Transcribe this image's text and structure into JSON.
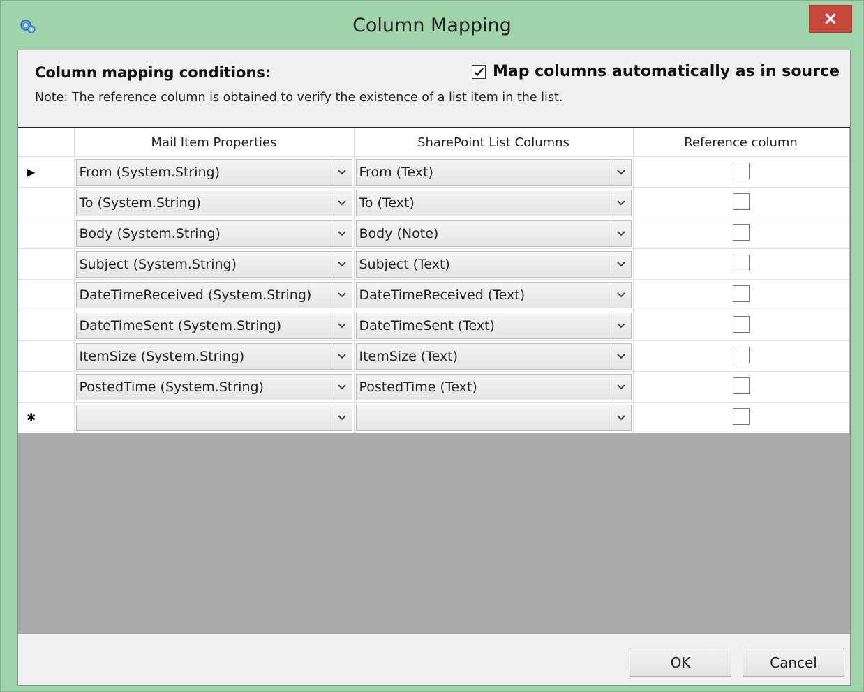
{
  "window": {
    "title": "Column Mapping",
    "close_glyph": "×",
    "accent_color": "#9fd3a9",
    "close_color": "#c7473c",
    "app_icon": "app-gear-icon"
  },
  "conditions": {
    "heading": "Column mapping conditions:",
    "auto_map_label": "Map columns automatically as in source",
    "auto_map_checked": true,
    "note": "Note: The reference column is obtained to verify the existence of a list item in the list."
  },
  "grid": {
    "columns": [
      "Mail Item Properties",
      "SharePoint List Columns",
      "Reference column"
    ],
    "current_row_marker": "▶",
    "new_row_marker": "✱",
    "rows": [
      {
        "mail": "From (System.String)",
        "sharepoint": "From (Text)",
        "reference": false
      },
      {
        "mail": "To (System.String)",
        "sharepoint": "To (Text)",
        "reference": false
      },
      {
        "mail": "Body (System.String)",
        "sharepoint": "Body (Note)",
        "reference": false
      },
      {
        "mail": "Subject (System.String)",
        "sharepoint": "Subject (Text)",
        "reference": false
      },
      {
        "mail": "DateTimeReceived (System.String)",
        "sharepoint": "DateTimeReceived (Text)",
        "reference": false
      },
      {
        "mail": "DateTimeSent (System.String)",
        "sharepoint": "DateTimeSent (Text)",
        "reference": false
      },
      {
        "mail": "ItemSize (System.String)",
        "sharepoint": "ItemSize (Text)",
        "reference": false
      },
      {
        "mail": "PostedTime (System.String)",
        "sharepoint": "PostedTime (Text)",
        "reference": false
      },
      {
        "mail": "",
        "sharepoint": "",
        "reference": false
      }
    ]
  },
  "buttons": {
    "ok": "OK",
    "cancel": "Cancel"
  }
}
